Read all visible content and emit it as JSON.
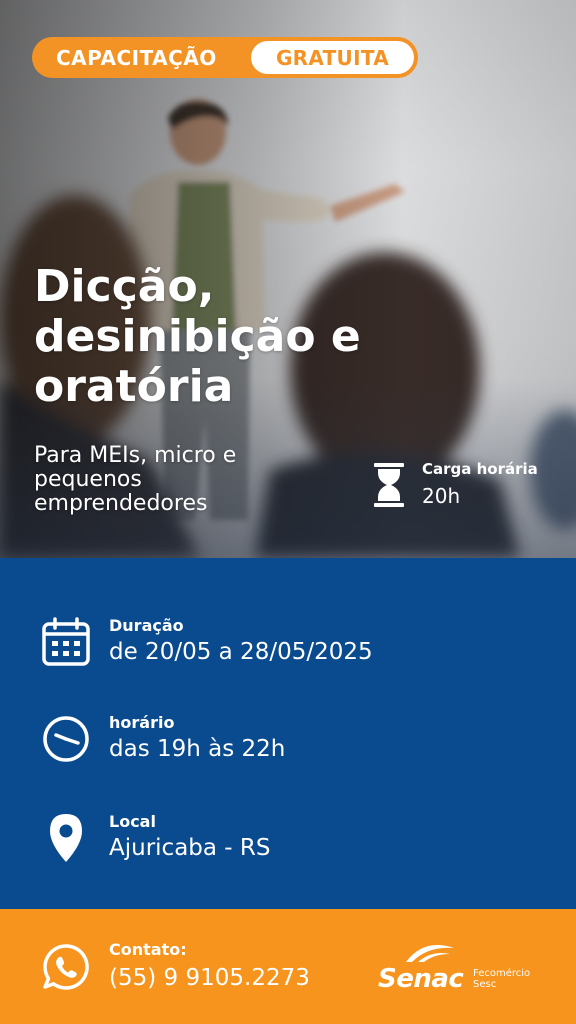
{
  "badge": {
    "left": "CAPACITAÇÃO",
    "right": "GRATUITA"
  },
  "title": "Dicção, desinibição e oratória",
  "subtitle": "Para MEIs, micro e pequenos emprendedores",
  "carga": {
    "label": "Carga horária",
    "value": "20h",
    "icon": "hourglass-icon"
  },
  "details": [
    {
      "icon": "calendar-icon",
      "label": "Duração",
      "value": "de 20/05 a 28/05/2025"
    },
    {
      "icon": "clock-icon",
      "label": "horário",
      "value": "das 19h às 22h"
    },
    {
      "icon": "location-pin-icon",
      "label": "Local",
      "value": "Ajuricaba - RS"
    }
  ],
  "contact": {
    "icon": "whatsapp-icon",
    "label": "Contato:",
    "value": "(55) 9 9105.2273"
  },
  "logo": {
    "brand": "Senac",
    "org_line1": "Fecomércio",
    "org_line2": "Sesc"
  },
  "colors": {
    "orange": "#f39325",
    "blue": "#0a4a8f",
    "white": "#ffffff"
  }
}
